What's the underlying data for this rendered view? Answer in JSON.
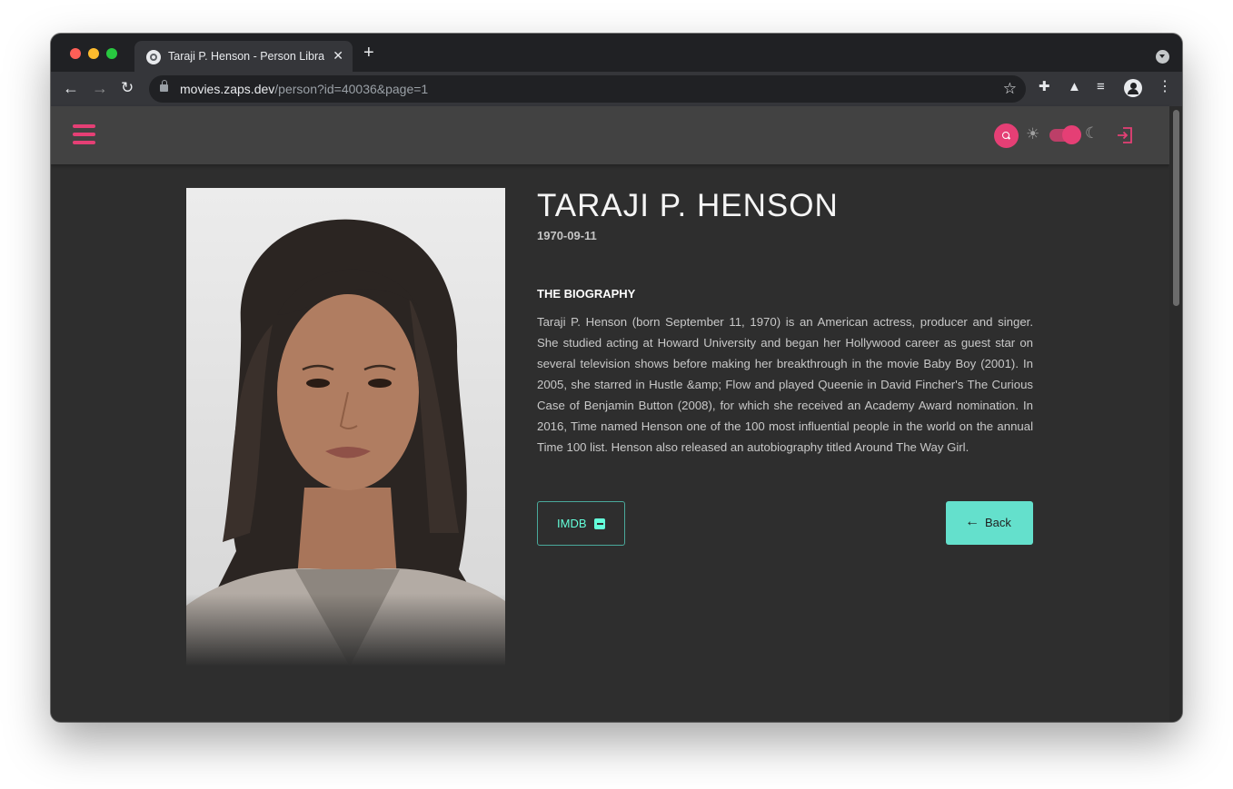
{
  "browser": {
    "tab_title": "Taraji P. Henson - Person Library",
    "tab_close": "✕",
    "new_tab": "+",
    "url_host": "movies.zaps.dev",
    "url_path": "/person?id=40036&page=1",
    "icons": [
      "back-arrow-icon",
      "forward-arrow-icon",
      "reload-icon",
      "lock-icon",
      "star-icon",
      "puzzle-icon",
      "flask-icon",
      "media-icon",
      "profile-icon",
      "kebab-menu-icon"
    ]
  },
  "app": {
    "accent": "#e53f75",
    "teal": "#64e0cc",
    "icons": [
      "hamburger-icon",
      "search-icon",
      "sun-icon",
      "moon-icon",
      "logout-icon"
    ],
    "dark_mode": true
  },
  "person": {
    "name": "TARAJI P. HENSON",
    "birthday": "1970-09-11",
    "bio_heading": "THE BIOGRAPHY",
    "bio": "Taraji P. Henson (born September 11, 1970) is an American actress, producer and singer. She studied acting at Howard University and began her Hollywood career as guest star on several television shows before making her breakthrough in the movie Baby Boy (2001). In 2005, she starred in Hustle &amp; Flow and played Queenie in David Fincher's The Curious Case of Benjamin Button (2008), for which she received an Academy Award nomination. In 2016, Time named Henson one of the 100 most influential people in the world on the annual Time 100 list. Henson also released an autobiography titled Around The Way Girl."
  },
  "actions": {
    "imdb_label": "IMDB",
    "back_label": "Back"
  }
}
